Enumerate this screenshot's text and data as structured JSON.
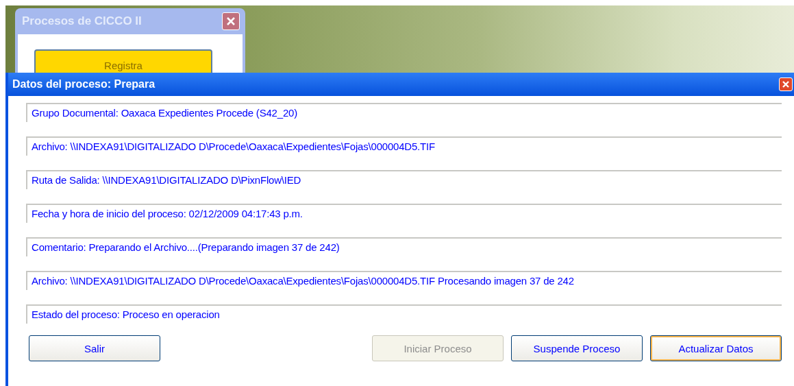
{
  "back_window": {
    "title": "Procesos de CICCO II",
    "button": "Registra"
  },
  "window": {
    "title": "Datos del proceso: Prepara"
  },
  "fields": [
    {
      "value": "Grupo Documental: Oaxaca Expedientes Procede (S42_20)"
    },
    {
      "value": "Archivo: \\\\INDEXA91\\DIGITALIZADO D\\Procede\\Oaxaca\\Expedientes\\Fojas\\000004D5.TIF"
    },
    {
      "value": "Ruta de Salida: \\\\INDEXA91\\DIGITALIZADO D\\PixnFlow\\IED"
    },
    {
      "value": "Fecha y hora de inicio del proceso: 02/12/2009 04:17:43 p.m."
    },
    {
      "value": "Comentario: Preparando el Archivo....(Preparando imagen 37 de 242)"
    },
    {
      "value": "Archivo: \\\\INDEXA91\\DIGITALIZADO D\\Procede\\Oaxaca\\Expedientes\\Fojas\\000004D5.TIF Procesando imagen 37 de 242"
    },
    {
      "value": "Estado del proceso: Proceso en operacion"
    }
  ],
  "buttons": [
    {
      "label": "Salir",
      "disabled": false,
      "focused": false
    },
    {
      "label": "Iniciar Proceso",
      "disabled": true,
      "focused": false
    },
    {
      "label": "Suspende Proceso",
      "disabled": false,
      "focused": false
    },
    {
      "label": "Actualizar Datos",
      "disabled": false,
      "focused": true
    }
  ]
}
